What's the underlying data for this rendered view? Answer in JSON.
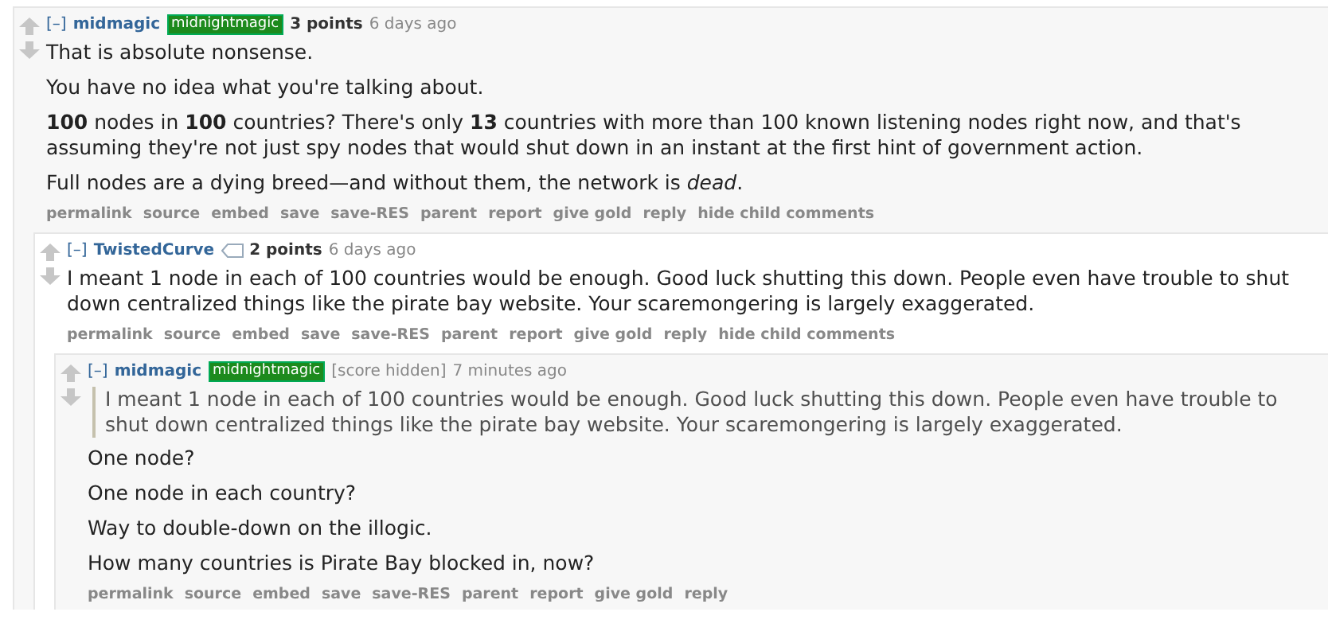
{
  "comment": {
    "toggle": "[–]",
    "author": "midmagic",
    "flair": "midnightmagic",
    "score": "3 points",
    "time": "6 days ago",
    "body": [
      "That is absolute nonsense.",
      "You have no idea what you're talking about.",
      "**100** nodes in **100** countries? There's only **13** countries with more than 100 known listening nodes right now, and that's assuming they're not just spy nodes that would shut down in an instant at the first hint of government action.",
      "Full nodes are a dying breed—and without them, the network is *dead*."
    ],
    "actions": [
      "permalink",
      "source",
      "embed",
      "save",
      "save-RES",
      "parent",
      "report",
      "give gold",
      "reply",
      "hide child comments"
    ],
    "children": [
      {
        "toggle": "[–]",
        "author": "TwistedCurve",
        "tagged": true,
        "score": "2 points",
        "time": "6 days ago",
        "body": [
          "I meant 1 node in each of 100 countries would be enough. Good luck shutting this down. People even have trouble to shut down centralized things like the pirate bay website. Your scaremongering is largely exaggerated."
        ],
        "actions": [
          "permalink",
          "source",
          "embed",
          "save",
          "save-RES",
          "parent",
          "report",
          "give gold",
          "reply",
          "hide child comments"
        ],
        "children": [
          {
            "toggle": "[–]",
            "author": "midmagic",
            "flair": "midnightmagic",
            "score": "[score hidden]",
            "time": "7 minutes ago",
            "quote": [
              "I meant 1 node in each of 100 countries would be enough. Good luck shutting this down. People even have trouble to shut down centralized things like the pirate bay website. Your scaremongering is largely exaggerated."
            ],
            "body": [
              "One node?",
              "One node in each country?",
              "Way to double-down on the illogic.",
              "How many countries is Pirate Bay blocked in, now?"
            ],
            "actions": [
              "permalink",
              "source",
              "embed",
              "save",
              "save-RES",
              "parent",
              "report",
              "give gold",
              "reply"
            ]
          }
        ]
      }
    ]
  }
}
